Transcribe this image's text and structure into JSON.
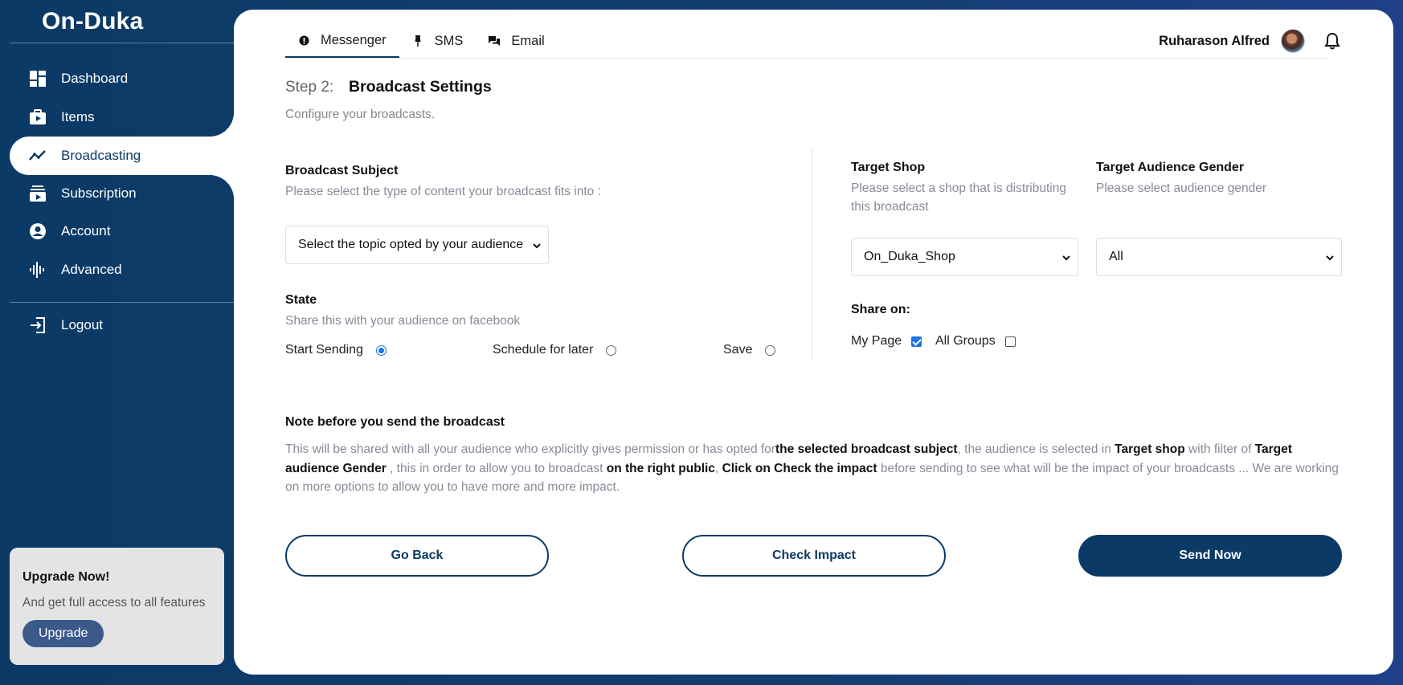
{
  "app": {
    "name": "On-Duka"
  },
  "sidebar": {
    "items": [
      {
        "label": "Dashboard",
        "icon": "dashboard-icon"
      },
      {
        "label": "Items",
        "icon": "items-icon"
      },
      {
        "label": "Broadcasting",
        "icon": "broadcast-icon",
        "active": true
      },
      {
        "label": "Subscription",
        "icon": "subscription-icon"
      },
      {
        "label": "Account",
        "icon": "account-icon"
      },
      {
        "label": "Advanced",
        "icon": "advanced-icon"
      }
    ],
    "logout": "Logout",
    "upgrade": {
      "title": "Upgrade Now!",
      "text": "And get full access to all features",
      "button": "Upgrade"
    }
  },
  "header": {
    "tabs": [
      {
        "label": "Messenger",
        "active": true
      },
      {
        "label": "SMS"
      },
      {
        "label": "Email"
      }
    ],
    "user_name": "Ruharason Alfred"
  },
  "page": {
    "step": "Step 2:",
    "title": "Broadcast Settings",
    "subtitle": "Configure your broadcasts."
  },
  "form": {
    "subject": {
      "label": "Broadcast Subject",
      "hint": "Please select the type of content your broadcast fits into :",
      "value": "Select the topic opted by your audience"
    },
    "state": {
      "label": "State",
      "hint": "Share this with your audience on facebook",
      "options": [
        {
          "label": "Start Sending",
          "checked": true
        },
        {
          "label": "Schedule for later",
          "checked": false
        },
        {
          "label": "Save",
          "checked": false
        }
      ]
    },
    "target_shop": {
      "label": "Target Shop",
      "hint_line1": "Please select a shop that is distributing",
      "hint_line2": "this broadcast",
      "value": "On_Duka_Shop"
    },
    "gender": {
      "label": "Target Audience Gender",
      "hint": "Please select audience gender",
      "value": "All"
    },
    "share": {
      "label": "Share on:",
      "options": [
        {
          "label": "My Page",
          "checked": true
        },
        {
          "label": "All Groups",
          "checked": false
        }
      ]
    }
  },
  "note": {
    "title": "Note before you send the broadcast",
    "p1": "This will be shared with all your audience who explicitly gives permission or has opted for",
    "b1": "the selected broadcast subject",
    "p2": ", the audience is selected in ",
    "b2": "Target shop",
    "p3": " with filter of ",
    "b3": "Target audience Gender",
    "p4": " , this in order to allow you to broadcast ",
    "b4": "on the right public",
    "p5": ", ",
    "b5": "Click on Check the impact",
    "p6": " before sending to see what will be the impact of your broadcasts ... We are working on more options to allow you to have more and more impact."
  },
  "actions": {
    "back": "Go Back",
    "impact": "Check Impact",
    "send": "Send Now"
  },
  "colors": {
    "primary": "#0b3a66",
    "accent": "#1a73e8"
  }
}
